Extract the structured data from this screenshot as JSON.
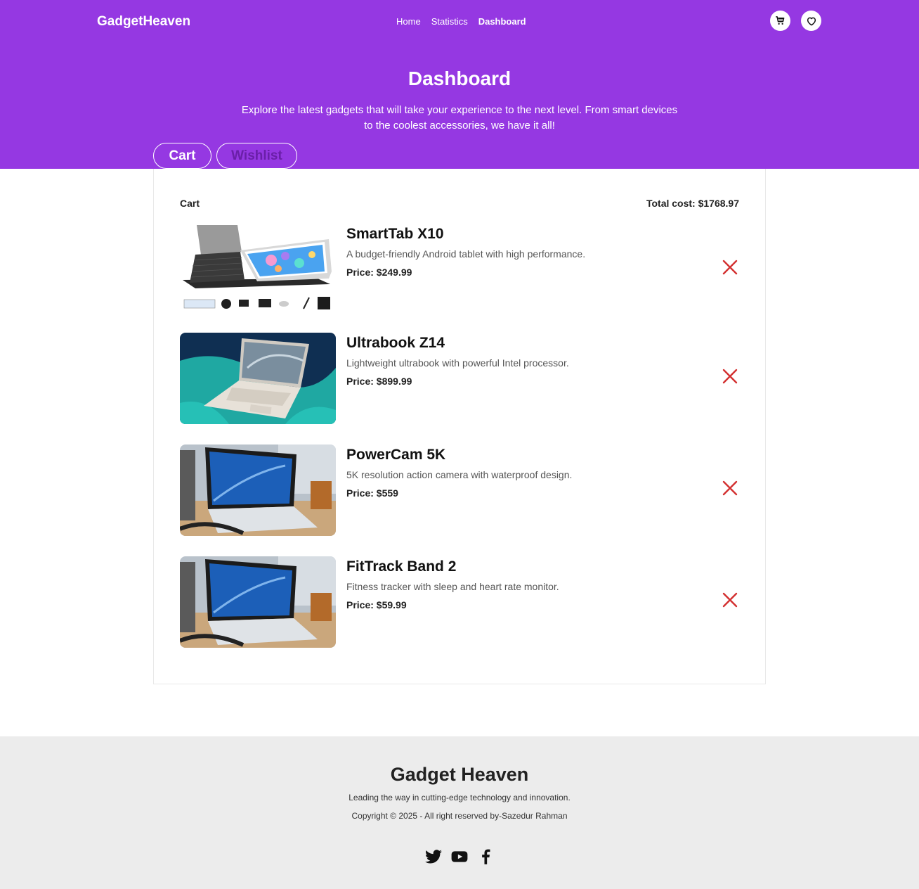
{
  "header": {
    "brand": "GadgetHeaven",
    "nav": [
      "Home",
      "Statistics",
      "Dashboard"
    ],
    "active_nav": "Dashboard",
    "icons": [
      "cart-icon",
      "heart-icon"
    ]
  },
  "hero": {
    "title": "Dashboard",
    "subtitle": "Explore the latest gadgets that will take your experience to the next level. From smart devices to the coolest accessories, we have it all!",
    "tabs": [
      "Cart",
      "Wishlist"
    ]
  },
  "cart": {
    "label": "Cart",
    "total": "Total cost: $1768.97",
    "items": [
      {
        "name": "SmartTab X10",
        "desc": "A budget-friendly Android tablet with high performance.",
        "price": "Price: $249.99"
      },
      {
        "name": "Ultrabook Z14",
        "desc": "Lightweight ultrabook with powerful Intel processor.",
        "price": "Price: $899.99"
      },
      {
        "name": "PowerCam 5K",
        "desc": "5K resolution action camera with waterproof design.",
        "price": "Price: $559"
      },
      {
        "name": "FitTrack Band 2",
        "desc": "Fitness tracker with sleep and heart rate monitor.",
        "price": "Price: $59.99"
      }
    ]
  },
  "footer": {
    "title": "Gadget Heaven",
    "tagline": "Leading the way in cutting-edge technology and innovation.",
    "copyright": "Copyright © 2025 - All right reserved by-Sazedur Rahman",
    "social": [
      "twitter-icon",
      "youtube-icon",
      "facebook-icon"
    ]
  },
  "colors": {
    "primary": "#9538e2",
    "remove": "#d32f2f",
    "footer_bg": "#ececec"
  }
}
